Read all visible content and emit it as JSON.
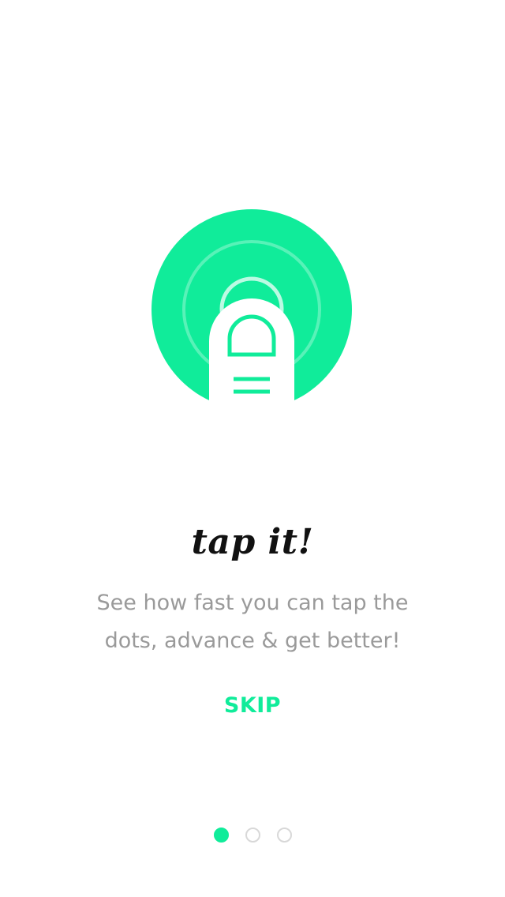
{
  "theme": {
    "accent": "#10ec9a",
    "title_color": "#111111",
    "subtitle_color": "#9a9a9a",
    "dot_inactive": "#d8d8d8"
  },
  "hero": {
    "icon": "finger-tap-icon"
  },
  "onboarding": {
    "title": "tap it!",
    "subtitle": "See how fast you can tap the dots, advance & get better!",
    "skip_label": "SKIP"
  },
  "pagination": {
    "total": 3,
    "active_index": 0
  }
}
